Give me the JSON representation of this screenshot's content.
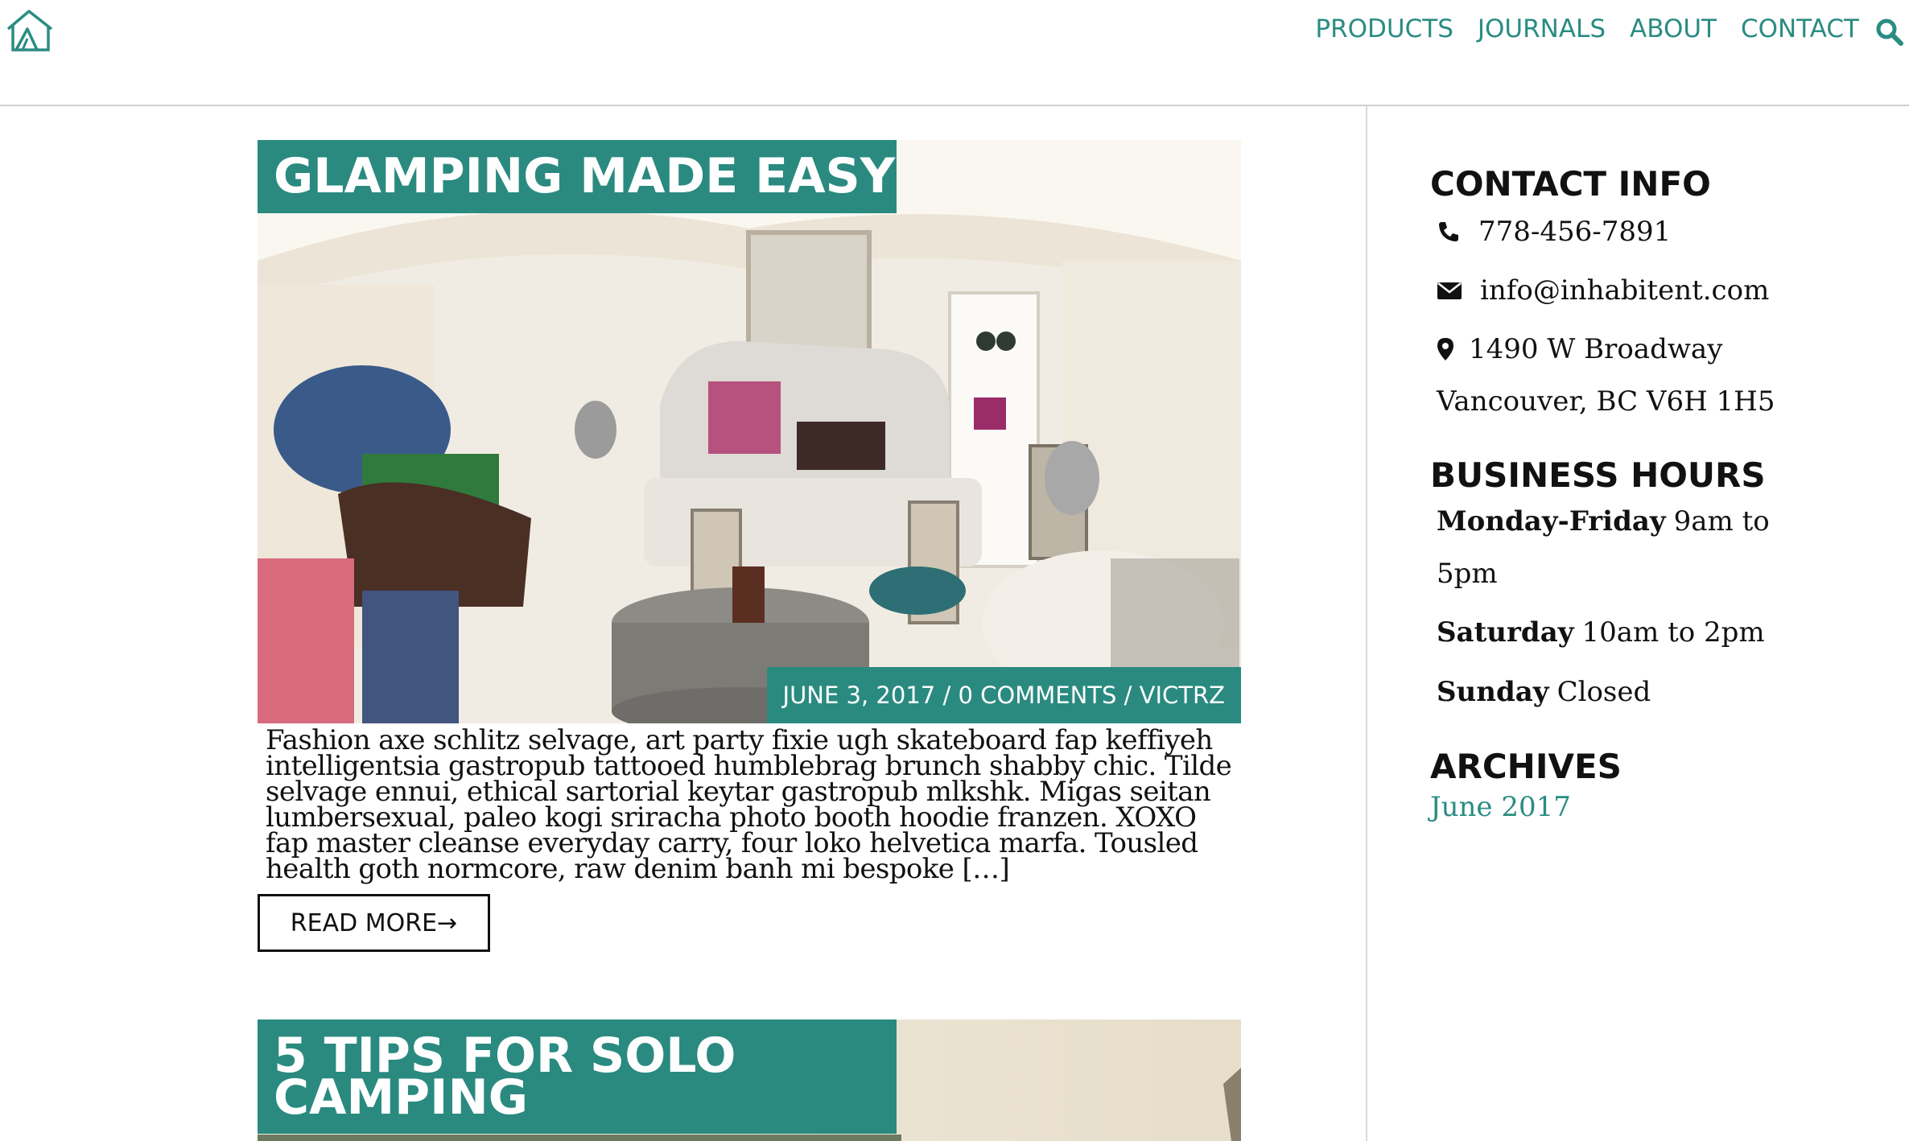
{
  "header": {
    "nav": [
      "PRODUCTS",
      "JOURNALS",
      "ABOUT",
      "CONTACT"
    ]
  },
  "posts": [
    {
      "title": "GLAMPING MADE EASY",
      "date": "JUNE 3, 2017",
      "comments": "0 COMMENTS",
      "author": "VICTRZ",
      "excerpt": "Fashion axe schlitz selvage, art party fixie ugh skateboard fap keffiyeh intelligentsia gastropub tattooed humblebrag brunch shabby chic. Tilde selvage ennui, ethical sartorial keytar gastropub mlkshk. Migas seitan lumbersexual, paleo kogi sriracha photo booth hoodie franzen. XOXO fap master cleanse everyday carry, four loko helvetica marfa. Tousled health goth normcore, raw denim banh mi bespoke […]",
      "read_more": "READ MORE→"
    },
    {
      "title_line1": "5 TIPS FOR SOLO",
      "title_line2": "CAMPING"
    }
  ],
  "sidebar": {
    "contact_title": "CONTACT INFO",
    "phone": "778-456-7891",
    "email": "info@inhabitent.com",
    "address1": "1490 W Broadway",
    "address2": "Vancouver, BC V6H 1H5",
    "hours_title": "BUSINESS HOURS",
    "hours": {
      "weekday_label": "Monday-Friday",
      "weekday_time_a": "9am to",
      "weekday_time_b": "5pm",
      "saturday_label": "Saturday",
      "saturday_time": "10am to 2pm",
      "sunday_label": "Sunday",
      "sunday_time": "Closed"
    },
    "archives_title": "ARCHIVES",
    "archive_link": "June 2017"
  },
  "colors": {
    "brand_teal": "#2a8a80",
    "link_teal": "#2a8c82"
  },
  "icons": [
    "tent-logo-icon",
    "search-icon",
    "phone-icon",
    "envelope-icon",
    "map-marker-icon"
  ]
}
